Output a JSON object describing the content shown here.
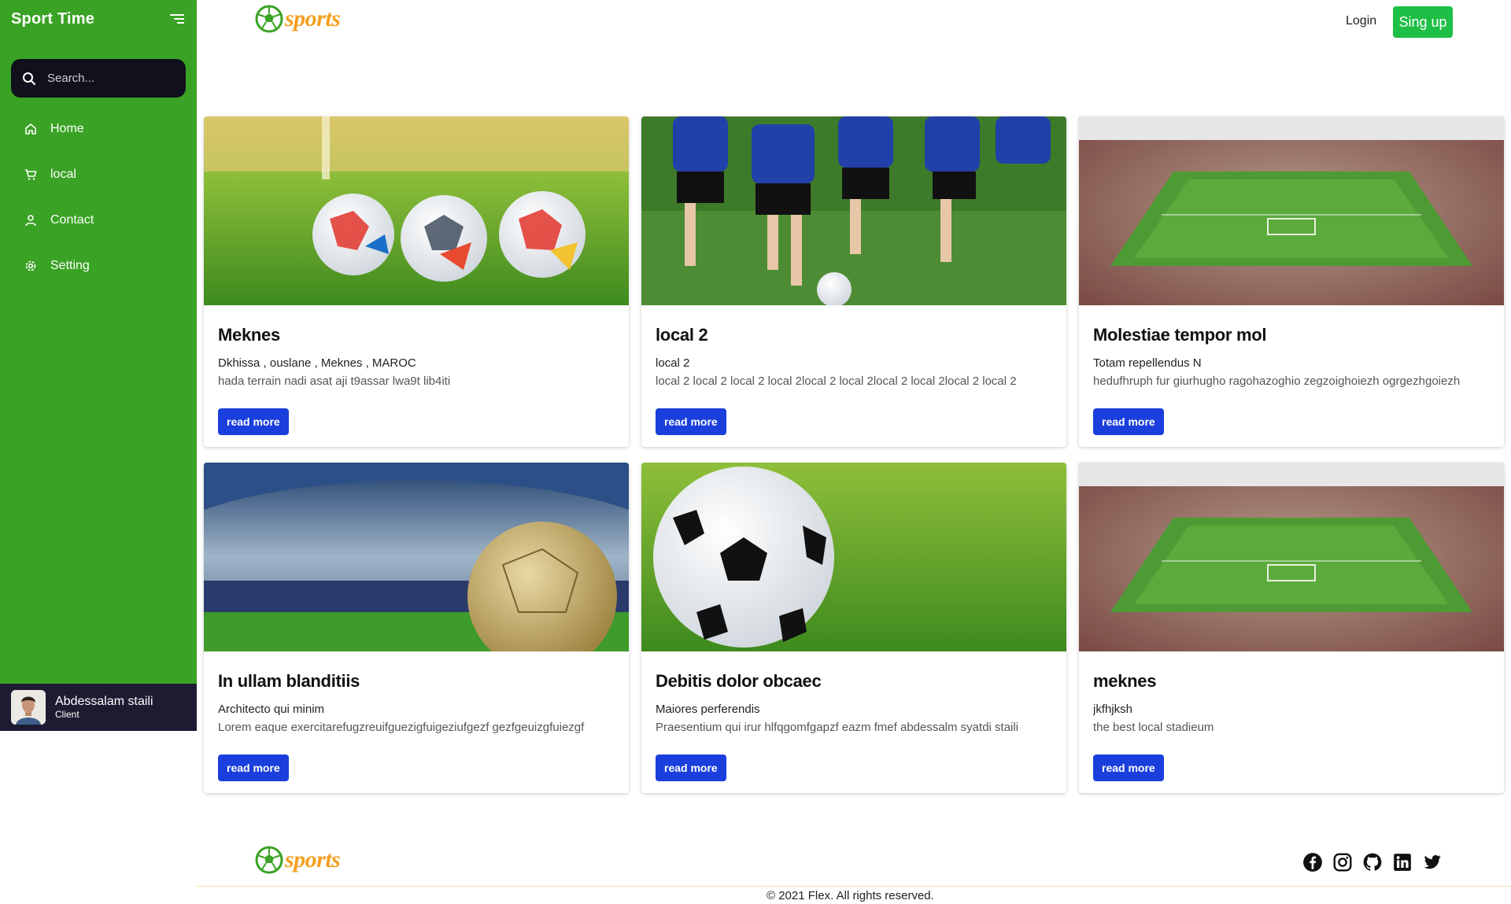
{
  "sidebar": {
    "title": "Sport Time",
    "search_placeholder": "Search...",
    "items": [
      {
        "label": "Home",
        "icon": "home-icon"
      },
      {
        "label": "local",
        "icon": "cart-icon"
      },
      {
        "label": "Contact",
        "icon": "user-icon"
      },
      {
        "label": "Setting",
        "icon": "gear-icon"
      }
    ],
    "user": {
      "name": "Abdessalam staili",
      "role": "Client"
    }
  },
  "header": {
    "logo_text": "sports",
    "login_label": "Login",
    "signup_label": "Sing up"
  },
  "cards": [
    {
      "title": "Meknes",
      "subtitle": "Dkhissa , ouslane , Meknes , MAROC",
      "description": "hada terrain nadi asat aji t9assar lwa9t lib4iti",
      "button": "read more",
      "image": "soccer-balls-on-grass"
    },
    {
      "title": "local 2",
      "subtitle": "local 2",
      "description": "local 2 local 2 local 2 local 2local 2 local 2local 2 local 2local 2 local 2",
      "button": "read more",
      "image": "kids-playing-soccer"
    },
    {
      "title": "Molestiae tempor mol",
      "subtitle": "Totam repellendus N",
      "description": "hedufhruph fur giurhugho ragohazoghio zegzoighoiezh ogrgezhgoiezh",
      "button": "read more",
      "image": "stadium-aerial"
    },
    {
      "title": "In ullam blanditiis",
      "subtitle": "Architecto qui minim",
      "description": "Lorem eaque exercitarefugzreuifguezigfuigeziufgezf gezfgeuizgfuiezgf",
      "button": "read more",
      "image": "golden-ball-stadium"
    },
    {
      "title": "Debitis dolor obcaec",
      "subtitle": "Maiores perferendis",
      "description": "Praesentium qui irur hlfqgomfgapzf eazm fmef abdessalm syatdi staili",
      "button": "read more",
      "image": "soccer-ball-on-grass"
    },
    {
      "title": "meknes",
      "subtitle": "jkfhjksh",
      "description": "the best local stadieum",
      "button": "read more",
      "image": "stadium-aerial"
    }
  ],
  "footer": {
    "logo_text": "sports",
    "copyright": "© 2021 Flex. All rights reserved.",
    "socials": [
      "facebook-icon",
      "instagram-icon",
      "github-icon",
      "linkedin-icon",
      "twitter-icon"
    ]
  },
  "colors": {
    "sidebar_bg": "#3aa224",
    "sidebar_dark": "#11101d",
    "user_panel": "#1d1b31",
    "signup_btn": "#1ebf46",
    "read_more_btn": "#1a3fdc",
    "logo_orange": "#f4a020"
  }
}
